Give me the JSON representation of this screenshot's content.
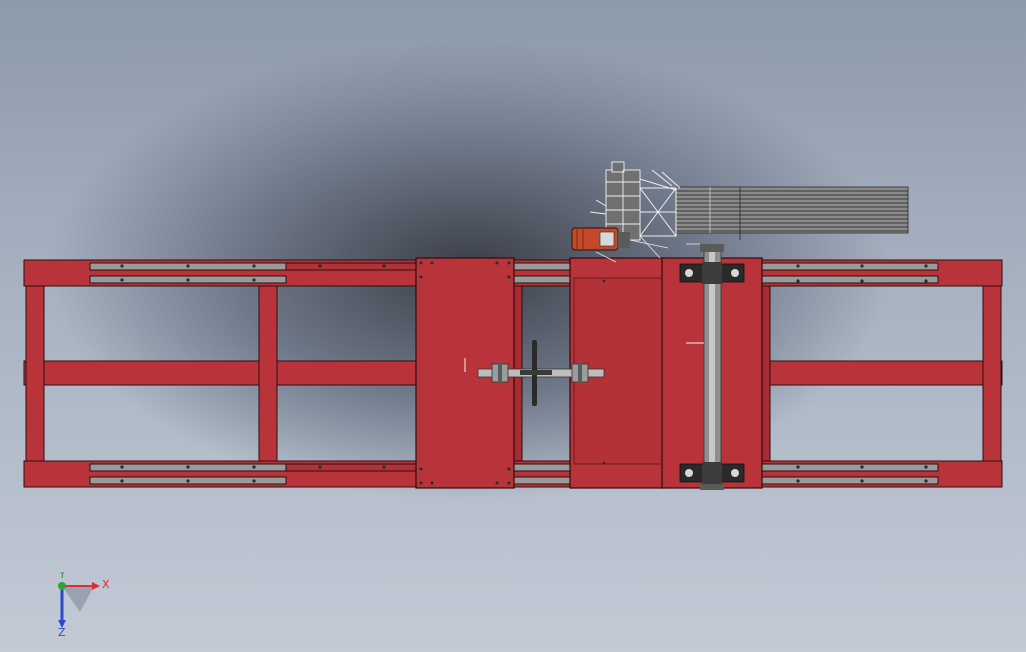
{
  "triad": {
    "x_label": "X",
    "y_label": "Y",
    "z_label": "Z"
  },
  "colors": {
    "frame_red": "#b8343a",
    "frame_dark": "#8a1f24",
    "rail_grey": "#9a9a9a",
    "steel": "#bdbdbd",
    "motor_red": "#c24a2a",
    "x_axis": "#d83030",
    "y_axis": "#2fa33a",
    "z_axis": "#2d49c8"
  },
  "icons": {
    "handwheel": "handwheel-icon",
    "motor": "motor-icon",
    "bearing": "pillow-block-bearing-icon"
  }
}
